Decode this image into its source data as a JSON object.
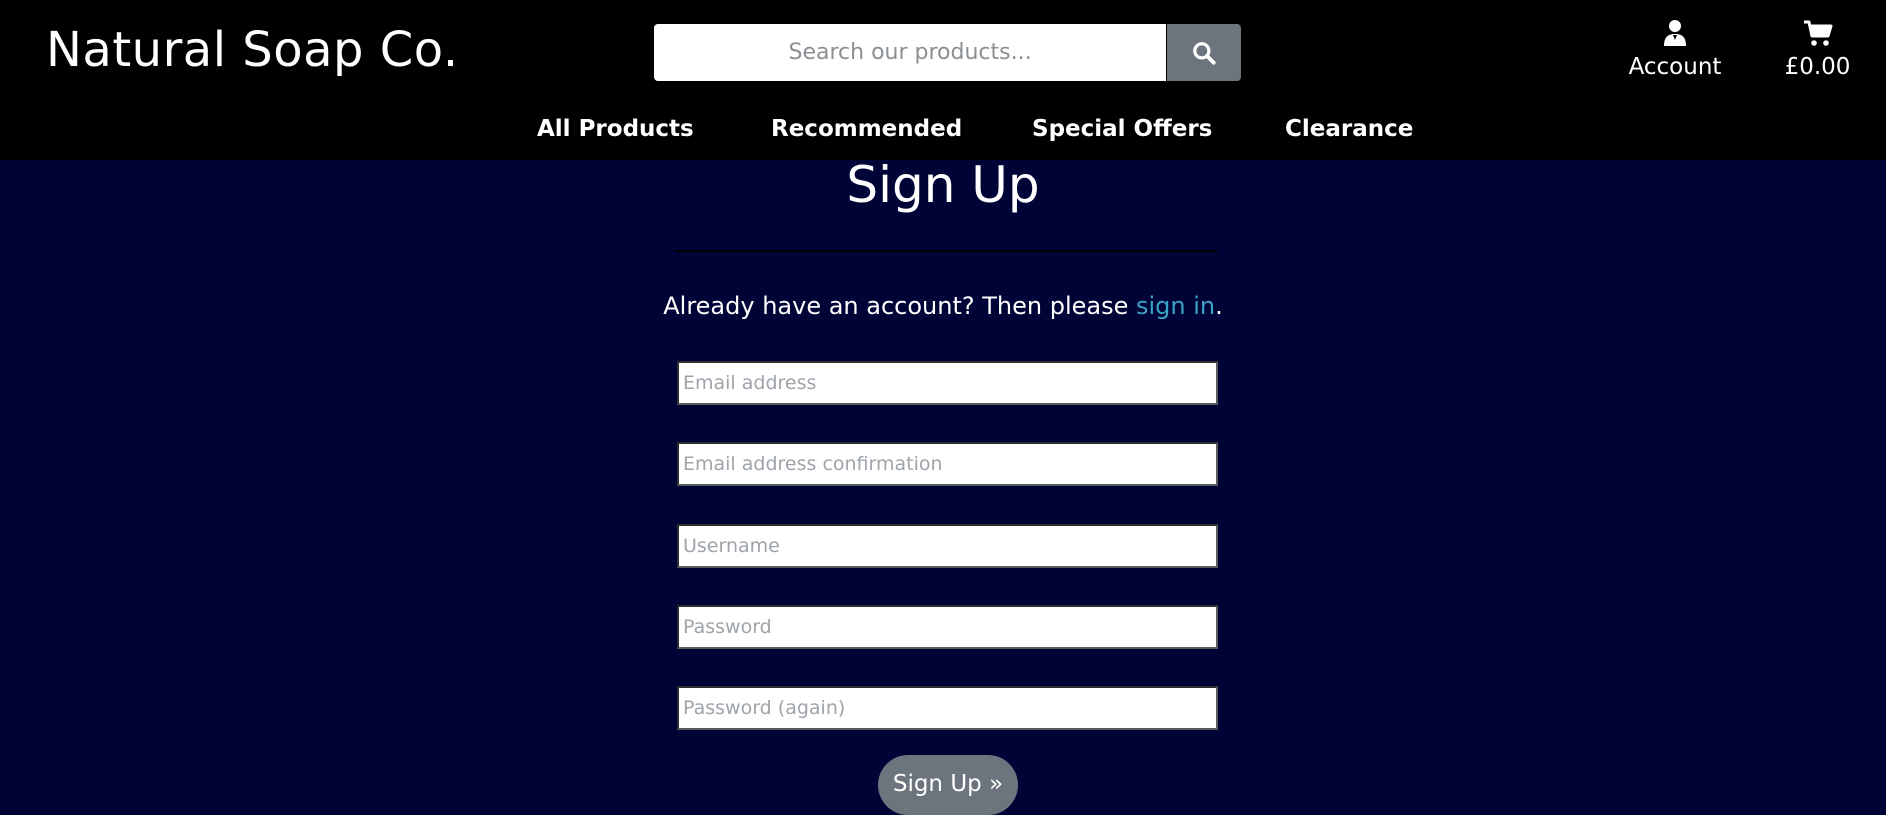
{
  "header": {
    "logo": "Natural Soap Co.",
    "search": {
      "placeholder": "Search our products...",
      "value": "",
      "button_icon": "search-icon"
    },
    "account": {
      "label": "Account",
      "icon": "user-icon"
    },
    "cart": {
      "label": "£0.00",
      "icon": "shopping-cart-icon"
    }
  },
  "nav": {
    "items": [
      {
        "label": "All Products"
      },
      {
        "label": "Recommended"
      },
      {
        "label": "Special Offers"
      },
      {
        "label": "Clearance"
      }
    ]
  },
  "main": {
    "title": "Sign Up",
    "signin_prefix": "Already have an account? Then please ",
    "signin_link": "sign in",
    "signin_suffix": ".",
    "fields": [
      {
        "placeholder": "Email address",
        "value": ""
      },
      {
        "placeholder": "Email address confirmation",
        "value": ""
      },
      {
        "placeholder": "Username",
        "value": ""
      },
      {
        "placeholder": "Password",
        "value": ""
      },
      {
        "placeholder": "Password (again)",
        "value": ""
      }
    ],
    "submit_label": "Sign Up »"
  },
  "colors": {
    "header_bg": "#000000",
    "page_bg": "#000335",
    "link": "#3aa3c8",
    "button_bg": "#6c757d"
  }
}
